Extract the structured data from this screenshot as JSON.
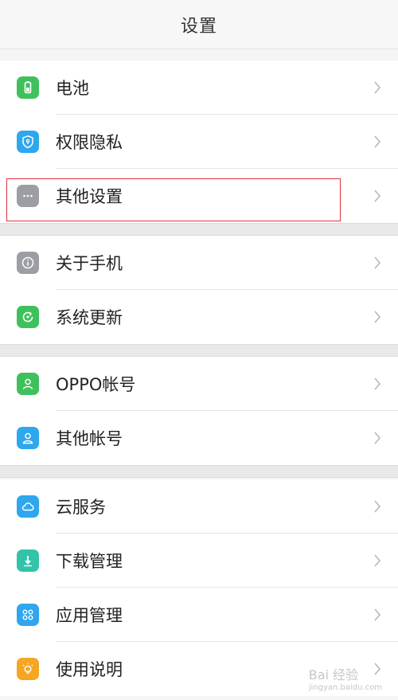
{
  "header": {
    "title": "设置"
  },
  "groups": [
    {
      "items": [
        {
          "label": "电池",
          "icon": "battery-icon",
          "color": "#3ec15c"
        },
        {
          "label": "权限隐私",
          "icon": "shield-icon",
          "color": "#2fa7ee"
        },
        {
          "label": "其他设置",
          "icon": "more-dots-icon",
          "color": "#9c9ea3"
        }
      ]
    },
    {
      "items": [
        {
          "label": "关于手机",
          "icon": "info-icon",
          "color": "#9c9ea3"
        },
        {
          "label": "系统更新",
          "icon": "update-icon",
          "color": "#3ec15c"
        }
      ]
    },
    {
      "items": [
        {
          "label": "OPPO帐号",
          "icon": "oppo-account-icon",
          "color": "#3ec15c"
        },
        {
          "label": "其他帐号",
          "icon": "user-icon",
          "color": "#2fa7ee"
        }
      ]
    },
    {
      "items": [
        {
          "label": "云服务",
          "icon": "cloud-icon",
          "color": "#2fa7ee"
        },
        {
          "label": "下载管理",
          "icon": "download-icon",
          "color": "#33c3a8"
        },
        {
          "label": "应用管理",
          "icon": "apps-icon",
          "color": "#2fa7ee"
        },
        {
          "label": "使用说明",
          "icon": "bulb-icon",
          "color": "#f5a623"
        }
      ]
    }
  ],
  "highlighted_item": "其他设置",
  "watermark": {
    "text": "Bai 经验",
    "sub": "jingyan.baidu.com"
  }
}
